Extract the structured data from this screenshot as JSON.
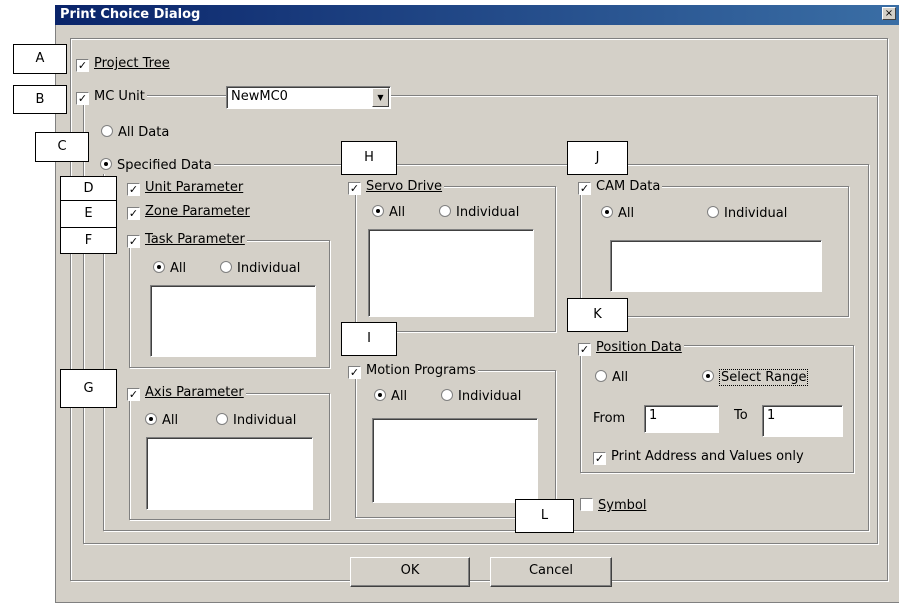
{
  "window": {
    "title": "Print Choice Dialog",
    "close_glyph": "×"
  },
  "callouts": [
    "A",
    "B",
    "C",
    "D",
    "E",
    "F",
    "G",
    "H",
    "I",
    "J",
    "K",
    "L"
  ],
  "project_tree": {
    "label": "Project Tree",
    "checked": true
  },
  "mc_unit": {
    "label": "MC Unit",
    "checked": true,
    "selected": "NewMC0"
  },
  "data_mode": {
    "all_data": "All Data",
    "specified_data": "Specified Data",
    "selected": "Specified Data"
  },
  "unit_parameter": {
    "label": "Unit Parameter",
    "checked": true
  },
  "zone_parameter": {
    "label": "Zone Parameter",
    "checked": true
  },
  "task_parameter": {
    "label": "Task Parameter",
    "checked": true,
    "all": "All",
    "individual": "Individual",
    "selected": "All"
  },
  "axis_parameter": {
    "label": "Axis Parameter",
    "checked": true,
    "all": "All",
    "individual": "Individual",
    "selected": "All"
  },
  "servo_drive": {
    "label": "Servo Drive",
    "checked": true,
    "all": "All",
    "individual": "Individual",
    "selected": "All"
  },
  "motion_programs": {
    "label": "Motion Programs",
    "checked": true,
    "all": "All",
    "individual": "Individual",
    "selected": "All"
  },
  "cam_data": {
    "label": "CAM Data",
    "checked": true,
    "all": "All",
    "individual": "Individual",
    "selected": "All"
  },
  "position_data": {
    "label": "Position Data",
    "checked": true,
    "all": "All",
    "select_range": "Select Range",
    "selected": "Select Range",
    "from_label": "From",
    "from_value": "1",
    "to_label": "To",
    "to_value": "1",
    "print_only_label": "Print  Address and Values only",
    "print_only_checked": true
  },
  "symbol": {
    "label": "Symbol",
    "checked": false
  },
  "buttons": {
    "ok": "OK",
    "cancel": "Cancel"
  },
  "icons": {
    "check": "checkmark-icon",
    "dropdown": "chevron-down-icon"
  }
}
